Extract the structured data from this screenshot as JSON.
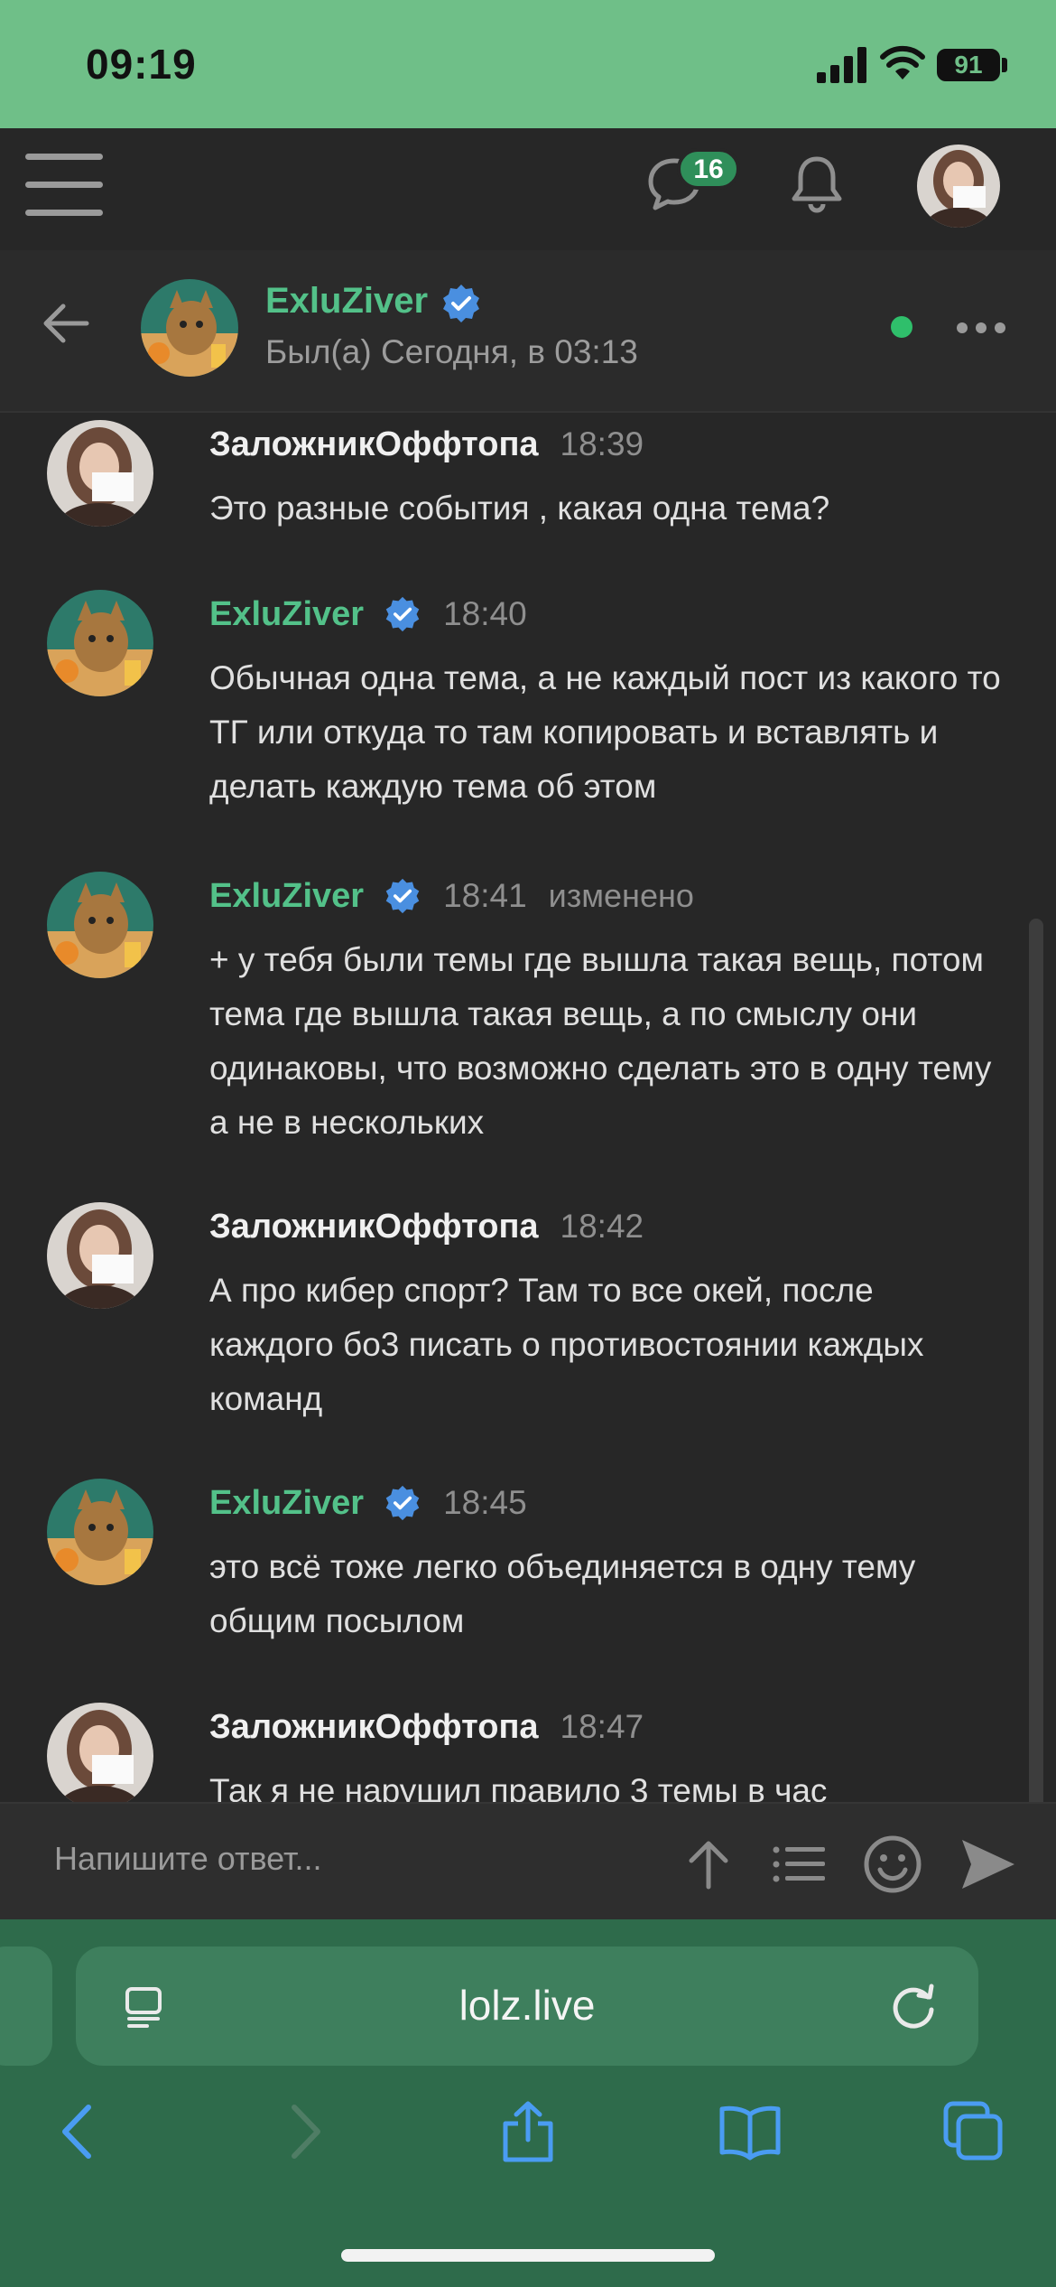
{
  "status_bar": {
    "time": "09:19",
    "battery": "91"
  },
  "nav": {
    "chat_badge_count": "16"
  },
  "conversation": {
    "name": "ExluZiver",
    "last_seen": "Был(а) Сегодня, в 03:13"
  },
  "messages": [
    {
      "author": "ЗаложникОффтопа",
      "author_color": "#f0f0f0",
      "verified": false,
      "time": "18:39",
      "edited": "",
      "text": "Это разные события , какая одна тема?"
    },
    {
      "author": "ExluZiver",
      "author_color": "#53c189",
      "verified": true,
      "time": "18:40",
      "edited": "",
      "text": "Обычная одна тема, а не каждый пост из какого то ТГ или откуда то там копировать и вставлять и делать каждую тема об этом"
    },
    {
      "author": "ExluZiver",
      "author_color": "#53c189",
      "verified": true,
      "time": "18:41",
      "edited": "изменено",
      "text": "+ у тебя были темы где вышла такая вещь, потом тема где вышла такая вещь, а по смыслу они одинаковы, что возможно сделать это в одну тему а не в нескольких"
    },
    {
      "author": "ЗаложникОффтопа",
      "author_color": "#f0f0f0",
      "verified": false,
      "time": "18:42",
      "edited": "",
      "text": "А про кибер спорт? Там то все окей, после каждого бо3 писать о противостоянии каждых команд"
    },
    {
      "author": "ExluZiver",
      "author_color": "#53c189",
      "verified": true,
      "time": "18:45",
      "edited": "",
      "text": "это всё тоже легко объединяется в одну тему общим посылом"
    },
    {
      "author": "ЗаложникОффтопа",
      "author_color": "#f0f0f0",
      "verified": false,
      "time": "18:47",
      "edited": "",
      "text": "Так я не нарушил правило 3 темы в час"
    }
  ],
  "reply": {
    "placeholder": "Напишите ответ..."
  },
  "browser": {
    "url": "lolz.live"
  },
  "colors": {
    "accent": "#53c189",
    "status_bar": "#6fbf88",
    "browser": "#2e6b4b",
    "background": "#272727",
    "verified": "#4a8fe0"
  }
}
